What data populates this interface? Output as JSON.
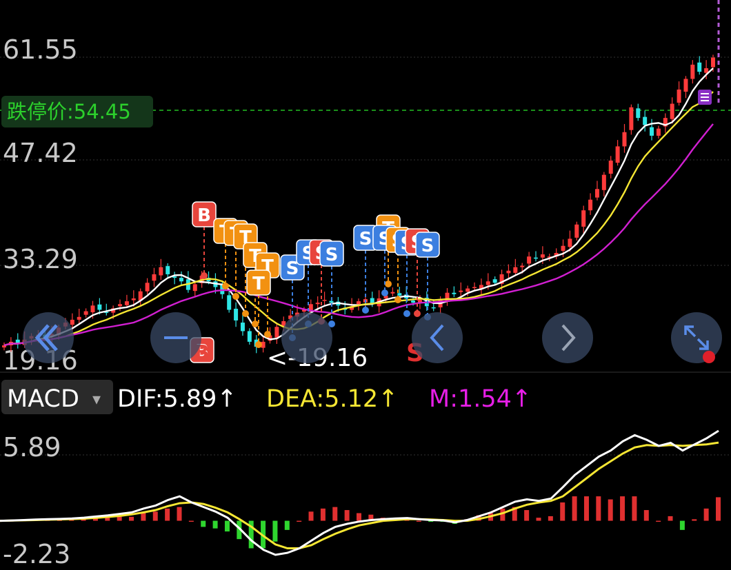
{
  "price_panel": {
    "y_labels": [
      "61.55",
      "47.42",
      "33.29",
      "19.16"
    ],
    "limit_down_label": "跌停价:54.45",
    "min_marker_label": "<-19.16",
    "colors": {
      "up": "#ff3b3b",
      "down": "#2ee6e6",
      "ma5": "#ffffff",
      "ma10": "#f5e633",
      "ma20": "#d11fd1",
      "limit_line": "#22c022",
      "buy_badge": "#e8453c",
      "t_badge": "#f29111",
      "s_badge": "#3c7fe0"
    }
  },
  "indicator": {
    "selector_label": "MACD",
    "selector_caret": "▾",
    "dif_label": "DIF:5.89↑",
    "dea_label": "DEA:5.12↑",
    "m_label": "M:1.54↑",
    "y_top": "5.89",
    "y_bottom": "-2.23",
    "colors": {
      "dif": "#ffffff",
      "dea": "#f5e633",
      "m": "#e61ee6"
    }
  },
  "badges": {
    "buy_letter": "B",
    "sell_letter": "S",
    "t_letter": "T"
  },
  "signals": {
    "bottom_buy": "B",
    "bottom_sell": "S"
  },
  "nav_icons": [
    "double-chevron-left-icon",
    "minus-icon",
    "chevron-left-icon",
    "chevron-right-icon",
    "expand-icon"
  ],
  "chart_data": [
    {
      "type": "candlestick",
      "ylim": [
        19.16,
        61.55
      ],
      "y_ticks": [
        19.16,
        33.29,
        47.42,
        61.55
      ],
      "limit_down_price": 54.45,
      "min_price": 19.16,
      "close_trend": [
        21.0,
        21.5,
        21.2,
        21.8,
        22.3,
        22.5,
        22.0,
        22.6,
        23.5,
        24.2,
        24.6,
        25.0,
        25.8,
        26.6,
        26.0,
        25.6,
        26.2,
        26.8,
        27.2,
        27.6,
        28.6,
        29.8,
        31.0,
        32.0,
        31.0,
        30.5,
        30.0,
        28.8,
        29.6,
        30.8,
        30.0,
        29.2,
        28.2,
        26.0,
        24.5,
        23.0,
        21.5,
        20.8,
        21.5,
        22.4,
        23.6,
        24.4,
        25.2,
        25.6,
        26.0,
        26.8,
        27.0,
        27.4,
        27.0,
        26.6,
        26.0,
        26.5,
        27.2,
        27.5,
        26.8,
        27.6,
        28.0,
        28.5,
        28.0,
        27.6,
        27.0,
        27.4,
        26.5,
        26.2,
        27.5,
        28.4,
        28.2,
        28.7,
        29.0,
        29.2,
        29.5,
        30.0,
        29.8,
        31.0,
        31.5,
        32.0,
        32.2,
        33.5,
        33.2,
        33.8,
        33.5,
        34.0,
        35.0,
        36.0,
        38.0,
        40.0,
        41.5,
        43.0,
        45.0,
        47.0,
        49.0,
        51.0,
        54.5,
        53.0,
        52.0,
        50.5,
        51.5,
        53.0,
        55.0,
        57.0,
        58.5,
        60.5,
        59.5,
        60.0,
        61.5
      ]
    },
    {
      "type": "line",
      "title": "MACD",
      "ylim": [
        -2.23,
        5.89
      ],
      "series": [
        {
          "name": "DIF",
          "last": 5.89
        },
        {
          "name": "DEA",
          "last": 5.12
        },
        {
          "name": "M",
          "last": 1.54
        }
      ],
      "dif": [
        0.0,
        0.02,
        0.05,
        0.08,
        0.1,
        0.12,
        0.15,
        0.2,
        0.28,
        0.35,
        0.45,
        0.55,
        0.8,
        1.0,
        1.35,
        1.6,
        1.2,
        0.9,
        0.6,
        0.2,
        -0.5,
        -1.3,
        -1.9,
        -2.23,
        -2.1,
        -1.8,
        -1.3,
        -0.8,
        -0.4,
        -0.2,
        -0.05,
        0.05,
        0.1,
        0.15,
        0.18,
        0.1,
        0.05,
        0.02,
        -0.1,
        0.05,
        0.3,
        0.55,
        0.9,
        1.25,
        1.4,
        1.3,
        1.45,
        2.2,
        3.0,
        3.6,
        4.2,
        4.6,
        5.2,
        5.6,
        5.3,
        4.9,
        5.1,
        4.6,
        5.0,
        5.4,
        5.89
      ],
      "dea": [
        0.0,
        0.01,
        0.03,
        0.05,
        0.07,
        0.09,
        0.11,
        0.14,
        0.19,
        0.25,
        0.32,
        0.42,
        0.55,
        0.7,
        0.95,
        1.15,
        1.2,
        1.1,
        0.85,
        0.55,
        0.1,
        -0.4,
        -1.0,
        -1.55,
        -1.8,
        -1.8,
        -1.6,
        -1.2,
        -0.85,
        -0.55,
        -0.3,
        -0.15,
        0.0,
        0.05,
        0.1,
        0.1,
        0.08,
        0.05,
        0.0,
        0.0,
        0.12,
        0.3,
        0.5,
        0.8,
        1.05,
        1.2,
        1.3,
        1.6,
        2.2,
        2.8,
        3.4,
        3.9,
        4.4,
        4.8,
        4.95,
        4.9,
        4.95,
        4.9,
        4.95,
        5.0,
        5.12
      ]
    }
  ]
}
